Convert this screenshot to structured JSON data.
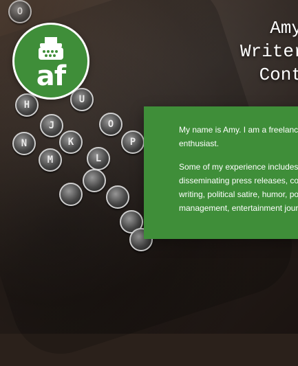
{
  "logo": {
    "text": "af",
    "icon": "typewriter-icon",
    "background": "#3f8e39",
    "foreground": "#ffffff"
  },
  "header": {
    "title_lines": [
      "Amy",
      "Writer",
      "Cont"
    ]
  },
  "content": {
    "paragraph_1_lines": [
      "My name is Amy. I am a freelance w",
      "enthusiast."
    ],
    "paragraph_2_lines": [
      "Some of my experience includes gh",
      "disseminating press releases, const",
      "writing, political satire, humor, polit",
      "management, entertainment journa"
    ],
    "panel_color": "#3f8e39"
  },
  "background": {
    "scene": "vintage typewriter keyboard",
    "keys": [
      "O",
      "H",
      "U",
      "J",
      "K",
      "M",
      "N",
      "P",
      "L",
      "O"
    ]
  }
}
